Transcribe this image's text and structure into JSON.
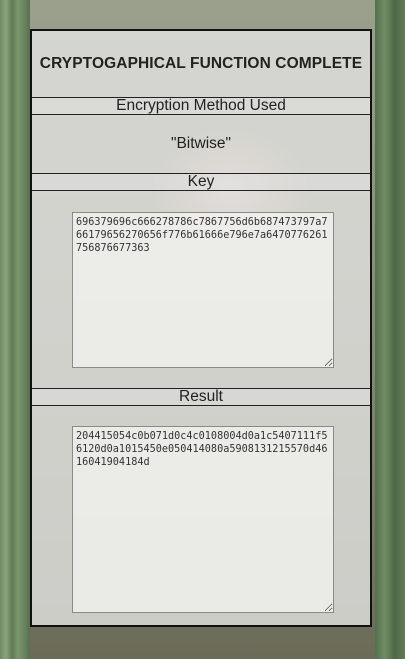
{
  "panel": {
    "title": "CRYPTOGAPHICAL FUNCTION COMPLETE",
    "method_label": "Encryption Method Used",
    "method_value": "\"Bitwise\"",
    "key_label": "Key",
    "key_value": "696379696c666278786c7867756d6b687473797a766179656270656f776b61666e796e7a6470776261756876677363",
    "result_label": "Result",
    "result_value": "204415054c0b071d0c4c0108004d0a1c5407111f56120d0a1015450e050414080a5908131215570d4616041904184d"
  }
}
